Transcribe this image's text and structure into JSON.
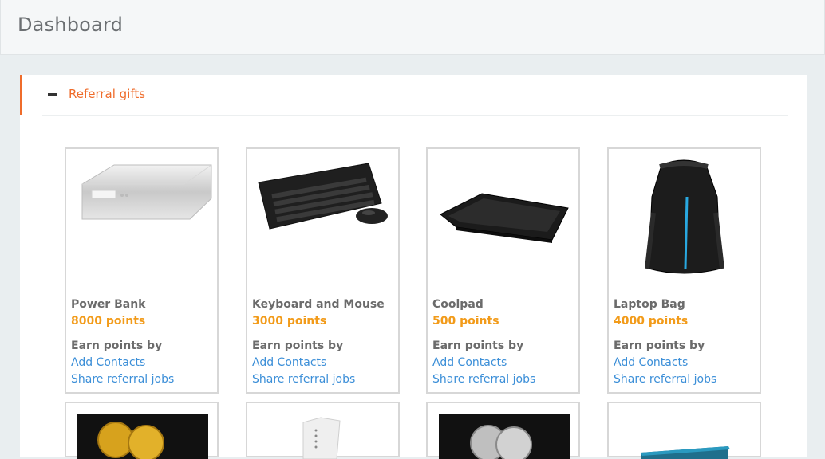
{
  "header": {
    "title": "Dashboard"
  },
  "panel": {
    "title": "Referral gifts",
    "collapse_icon": "minus-icon"
  },
  "gifts": [
    {
      "name": "Power Bank",
      "points": "8000 points",
      "earn_label": "Earn points by",
      "link1": "Add Contacts",
      "link2": "Share referral jobs",
      "image": "power-bank-image"
    },
    {
      "name": "Keyboard and Mouse",
      "points": "3000 points",
      "earn_label": "Earn points by",
      "link1": "Add Contacts",
      "link2": "Share referral jobs",
      "image": "keyboard-mouse-image"
    },
    {
      "name": "Coolpad",
      "points": "500 points",
      "earn_label": "Earn points by",
      "link1": "Add Contacts",
      "link2": "Share referral jobs",
      "image": "coolpad-image"
    },
    {
      "name": "Laptop Bag",
      "points": "4000 points",
      "earn_label": "Earn points by",
      "link1": "Add Contacts",
      "link2": "Share referral jobs",
      "image": "laptop-bag-image"
    }
  ],
  "colors": {
    "accent": "#ef6c2b",
    "points": "#f29b1a",
    "link": "#3c8fd8"
  }
}
